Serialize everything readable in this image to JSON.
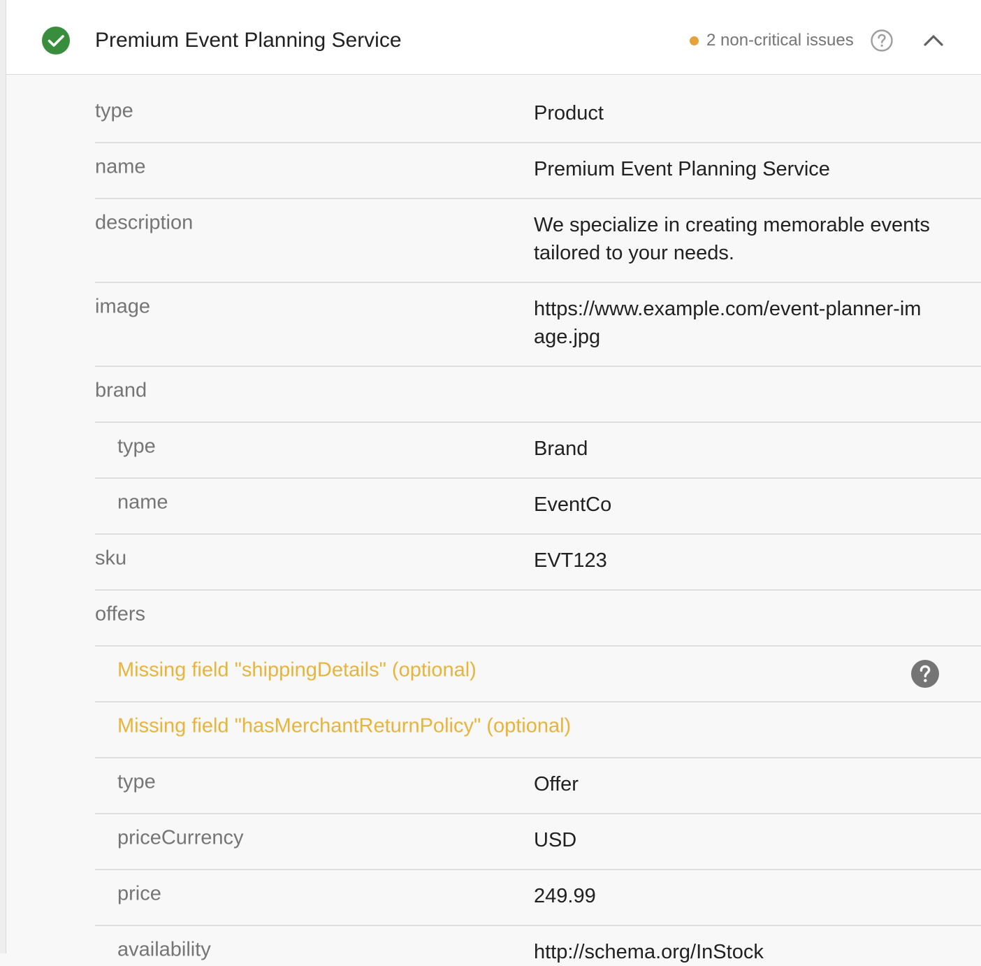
{
  "header": {
    "title": "Premium Event Planning Service",
    "issues_text": "2 non-critical issues",
    "issue_dot_color": "#e8a23a",
    "status_color": "#388e3c"
  },
  "rows": [
    {
      "key": "type",
      "value": "Product"
    },
    {
      "key": "name",
      "value": "Premium Event Planning Service"
    },
    {
      "key": "description",
      "value": "We specialize in creating memorable events tailored to your needs."
    },
    {
      "key": "image",
      "value": "https://www.example.com/event-planner-im age.jpg"
    },
    {
      "key": "brand",
      "value": ""
    },
    {
      "key": "type",
      "value": "Brand"
    },
    {
      "key": "name",
      "value": "EventCo"
    },
    {
      "key": "sku",
      "value": "EVT123"
    },
    {
      "key": "offers",
      "value": ""
    },
    {
      "key": "Missing field \"shippingDetails\" (optional)",
      "value": ""
    },
    {
      "key": "Missing field \"hasMerchantReturnPolicy\" (optional)",
      "value": ""
    },
    {
      "key": "type",
      "value": "Offer"
    },
    {
      "key": "priceCurrency",
      "value": "USD"
    },
    {
      "key": "price",
      "value": "249.99"
    },
    {
      "key": "availability",
      "value": "http://schema.org/InStock"
    }
  ],
  "warning_color": "#e8b43b"
}
